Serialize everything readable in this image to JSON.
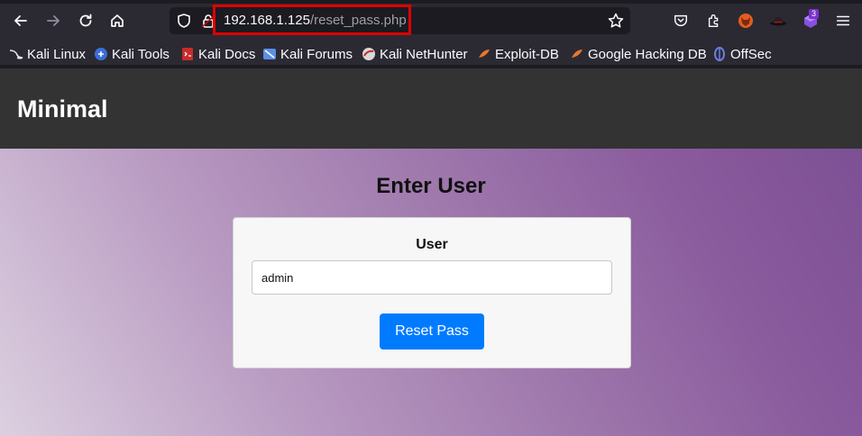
{
  "browser": {
    "url_host": "192.168.1.125",
    "url_path": "/reset_pass.php",
    "extension_badge": "3"
  },
  "bookmarks": [
    {
      "label": "Kali Linux",
      "icon": "kali-dragon-icon"
    },
    {
      "label": "Kali Tools",
      "icon": "kali-tools-icon"
    },
    {
      "label": "Kali Docs",
      "icon": "kali-docs-icon"
    },
    {
      "label": "Kali Forums",
      "icon": "kali-forums-icon"
    },
    {
      "label": "Kali NetHunter",
      "icon": "nethunter-icon"
    },
    {
      "label": "Exploit-DB",
      "icon": "exploit-db-icon"
    },
    {
      "label": "Google Hacking DB",
      "icon": "ghdb-icon"
    },
    {
      "label": "OffSec",
      "icon": "offsec-icon"
    }
  ],
  "site": {
    "brand": "Minimal"
  },
  "form": {
    "title": "Enter User",
    "field_label": "User",
    "field_value": "admin",
    "submit_label": "Reset Pass"
  },
  "colors": {
    "accent": "#007bff",
    "header_bg": "#333333",
    "url_highlight": "#e00000"
  }
}
